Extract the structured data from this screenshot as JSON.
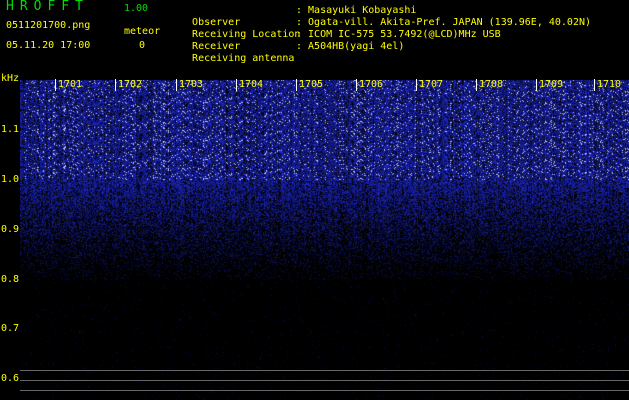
{
  "app": {
    "title": "HROFFT",
    "version": "1.00"
  },
  "file": {
    "name": "0511201700.png",
    "timestamp": "05.11.20 17:00"
  },
  "meteor": {
    "label": "meteor",
    "count": "0"
  },
  "info": [
    {
      "label": "Observer",
      "value": ": Masayuki Kobayashi"
    },
    {
      "label": "Receiving Location",
      "value": ": Ogata-vill. Akita-Pref. JAPAN (139.96E, 40.02N)"
    },
    {
      "label": "Receiver",
      "value": ": ICOM IC-575 53.7492(@LCD)MHz USB"
    },
    {
      "label": "Receiving antenna",
      "value": ": A504HB(yagi 4el)"
    }
  ],
  "y_axis": {
    "unit": "kHz",
    "ticks": [
      "1.1",
      "1.0",
      "0.9",
      "0.8",
      "0.7",
      "0.6"
    ]
  },
  "x_axis": {
    "ticks": [
      "1701",
      "1702",
      "1703",
      "1704",
      "1705",
      "1706",
      "1707",
      "1708",
      "1709",
      "1710"
    ]
  },
  "colors": {
    "label": "#ffff00",
    "title": "#00dd00",
    "noise": "#2a3aff",
    "tick": "#ffffff"
  }
}
